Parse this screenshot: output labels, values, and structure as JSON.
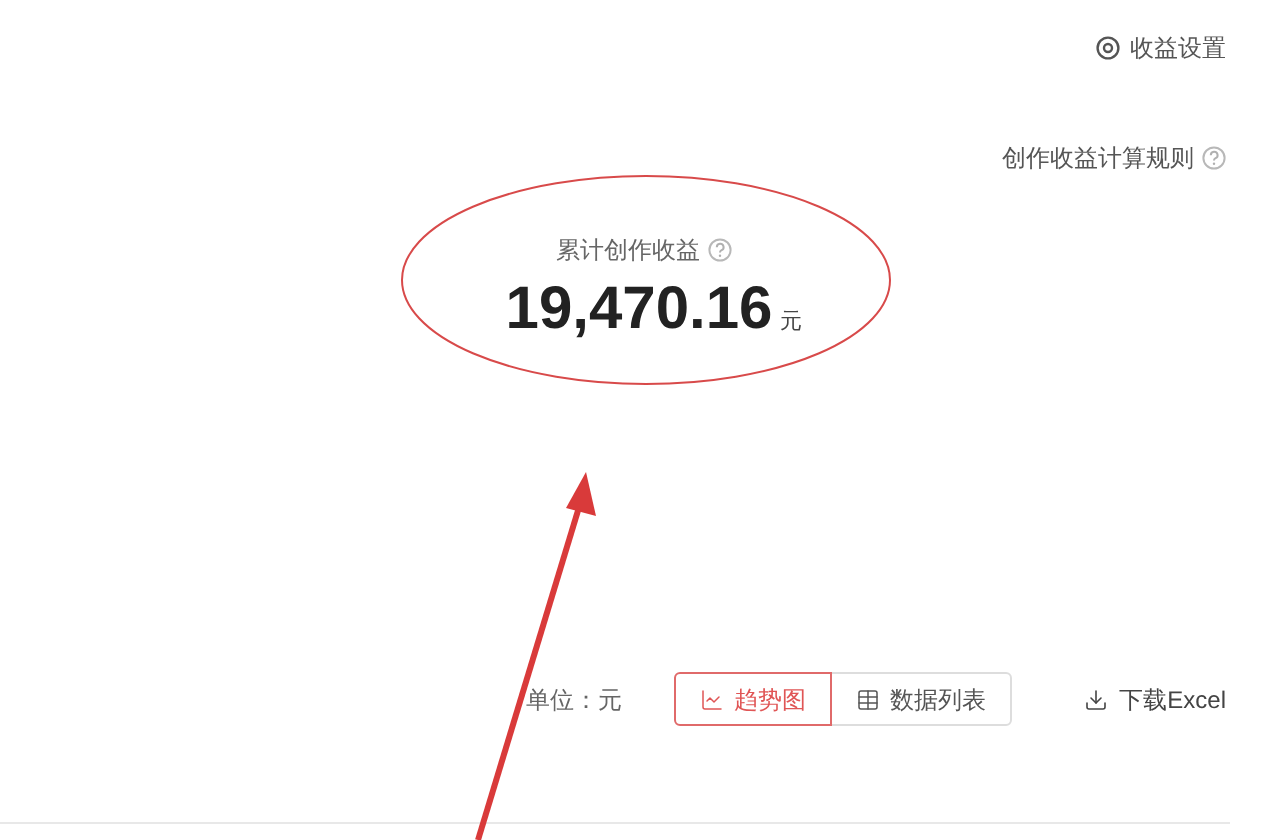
{
  "settings_link": "收益设置",
  "rules_link": "创作收益计算规则",
  "summary": {
    "label": "累计创作收益",
    "amount": "19,470.16",
    "unit": "元"
  },
  "toolbar": {
    "unit_label": "单位：元",
    "tabs": [
      {
        "label": "趋势图",
        "kind": "chart",
        "selected": true
      },
      {
        "label": "数据列表",
        "kind": "table",
        "selected": false
      }
    ],
    "download": "下载Excel"
  }
}
